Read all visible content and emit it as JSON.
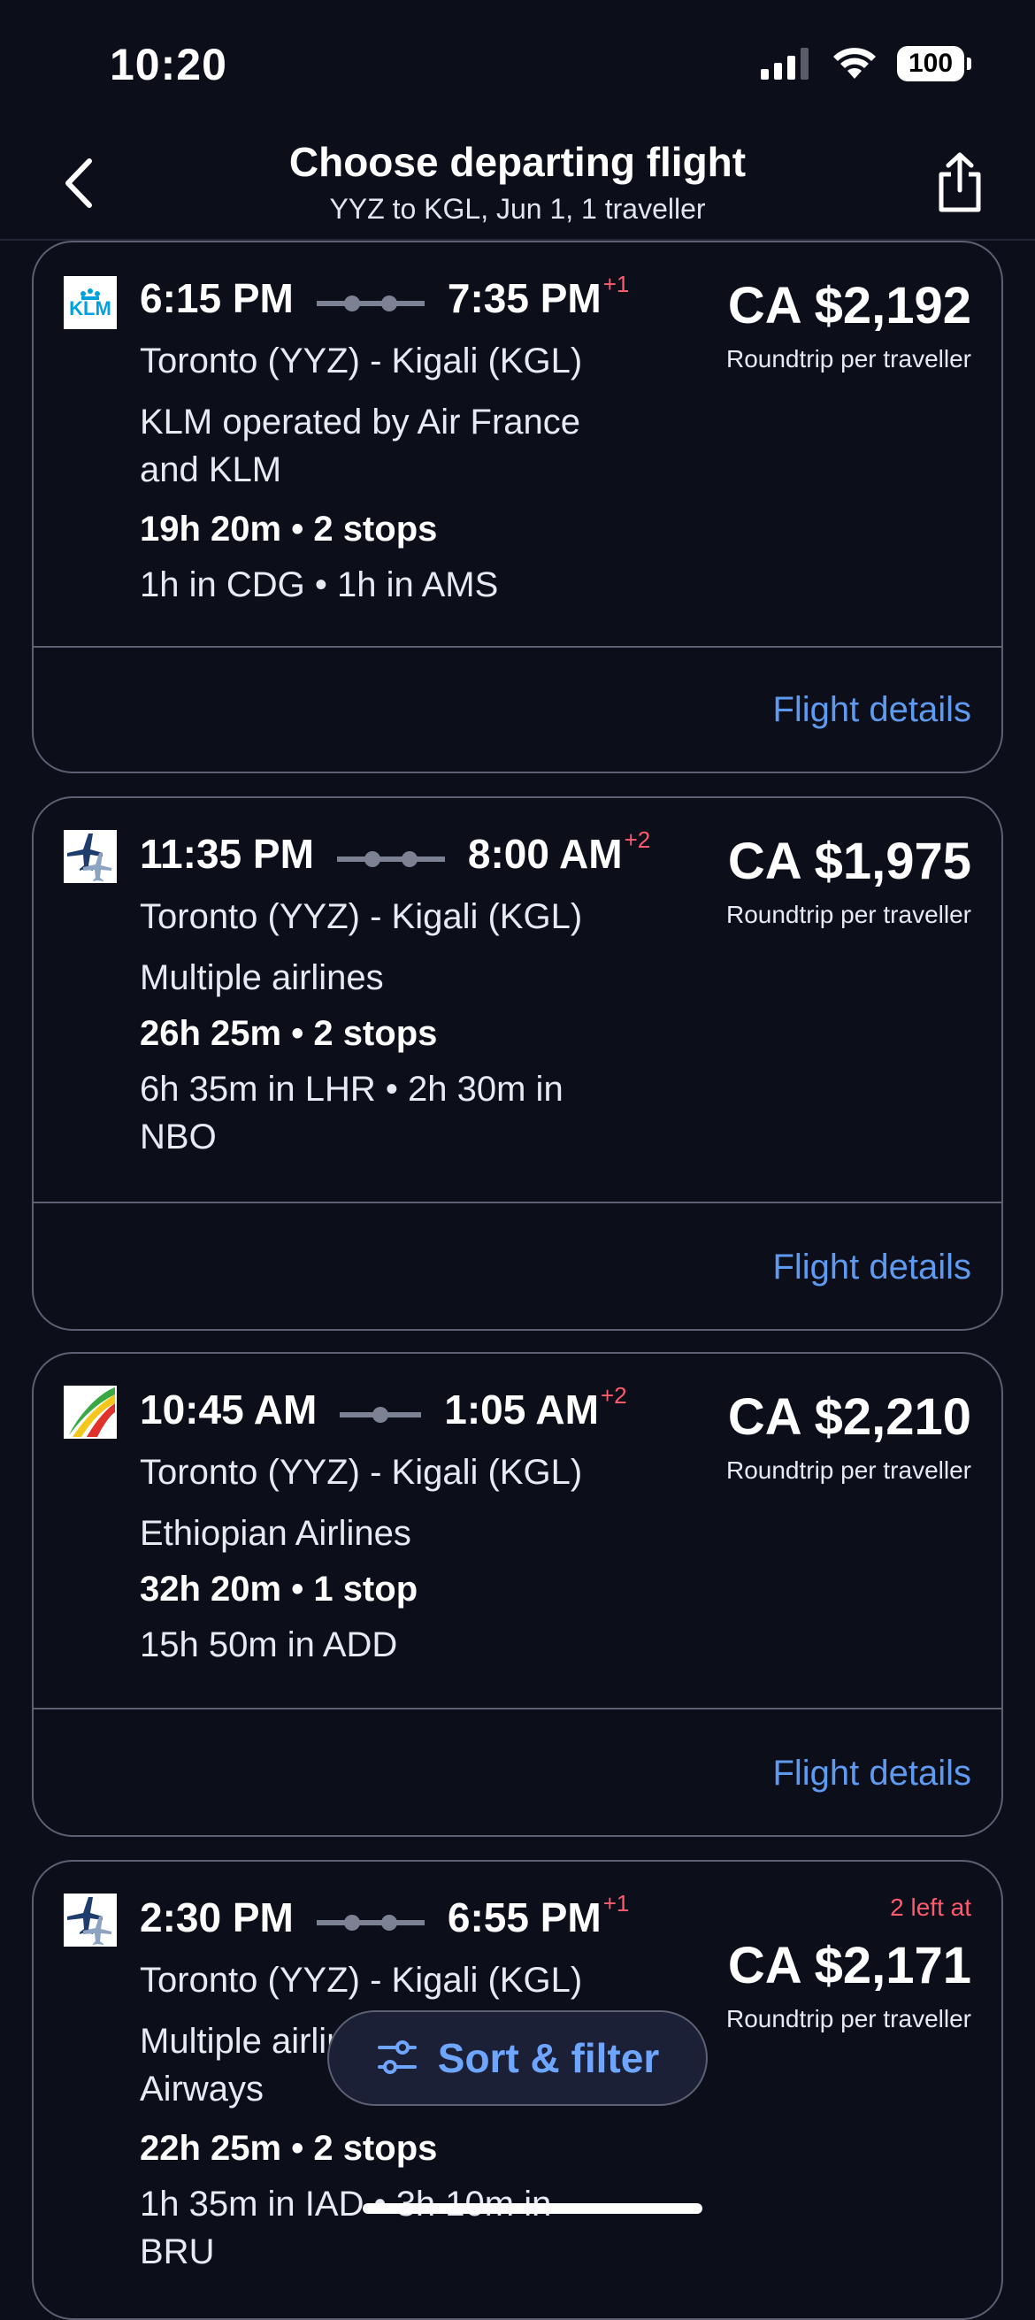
{
  "status_bar": {
    "time": "10:20",
    "battery": "100"
  },
  "header": {
    "title": "Choose departing flight",
    "subtitle": "YYZ to KGL, Jun 1, 1 traveller"
  },
  "flights": [
    {
      "logo": "klm-logo",
      "logo_text": "KLM",
      "depart": "6:15 PM",
      "arrive": "7:35 PM",
      "day_offset": "+1",
      "route": "Toronto (YYZ) - Kigali (KGL)",
      "airline": "KLM operated by Air France and KLM",
      "duration": "19h 20m • 2 stops",
      "layover": "1h in CDG • 1h in AMS",
      "price": "CA $2,192",
      "price_note": "Roundtrip per traveller",
      "details_label": "Flight details"
    },
    {
      "logo": "multiple-airlines-icon",
      "depart": "11:35 PM",
      "arrive": "8:00 AM",
      "day_offset": "+2",
      "route": "Toronto (YYZ) - Kigali (KGL)",
      "airline": "Multiple airlines",
      "duration": "26h 25m • 2 stops",
      "layover": "6h 35m in LHR • 2h 30m in NBO",
      "price": "CA $1,975",
      "price_note": "Roundtrip per traveller",
      "details_label": "Flight details"
    },
    {
      "logo": "ethiopian-airlines-logo",
      "depart": "10:45 AM",
      "arrive": "1:05 AM",
      "day_offset": "+2",
      "route": "Toronto (YYZ) - Kigali (KGL)",
      "airline": "Ethiopian Airlines",
      "duration": "32h 20m • 1 stop",
      "layover": "15h 50m in ADD",
      "price": "CA $2,210",
      "price_note": "Roundtrip per traveller",
      "details_label": "Flight details"
    },
    {
      "logo": "multiple-airlines-icon",
      "depart": "2:30 PM",
      "arrive": "6:55 PM",
      "day_offset": "+1",
      "route": "Toronto (YYZ) - Kigali (KGL)",
      "airline": "Multiple airlines Republic Airways",
      "duration": "22h 25m • 2 stops",
      "layover": "1h 35m in IAD • 3h 10m in BRU",
      "seats_left": "2 left at",
      "price": "CA $2,171",
      "price_note": "Roundtrip per traveller"
    }
  ],
  "sort_filter": {
    "label": "Sort & filter"
  },
  "colors": {
    "background": "#0c0e1a",
    "card_border": "#5c6072",
    "accent_link": "#5e9bf0",
    "alert": "#ff5a6e"
  }
}
